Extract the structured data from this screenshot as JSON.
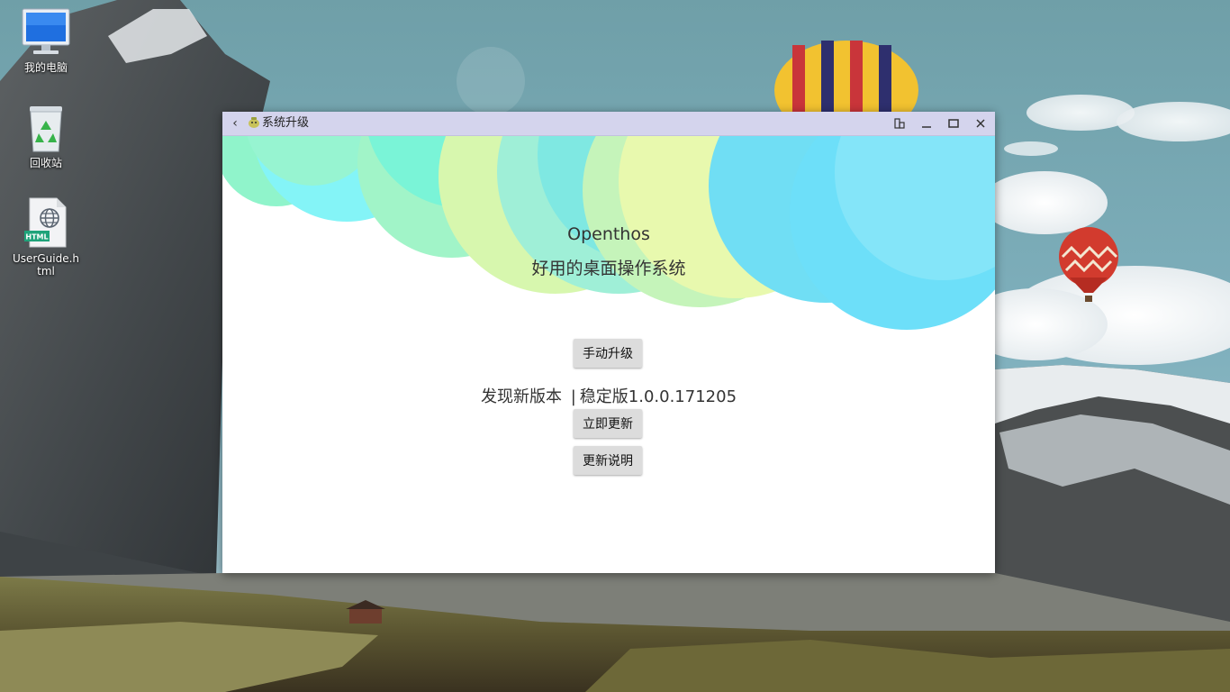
{
  "desktop": {
    "icons": [
      {
        "label": "我的电脑",
        "icon": "computer-icon"
      },
      {
        "label": "回收站",
        "icon": "recycle-bin-icon"
      },
      {
        "label": "UserGuide.html",
        "icon": "html-file-icon",
        "badge": "HTML"
      }
    ]
  },
  "window": {
    "title": "系统升级",
    "controls": [
      "back-icon",
      "app-icon",
      "compat-mode-icon",
      "minimize-icon",
      "maximize-icon",
      "close-icon"
    ]
  },
  "hero": {
    "brand": "Openthos",
    "slogan": "好用的桌面操作系统"
  },
  "actions": {
    "manual_upgrade": "手动升级",
    "update_now": "立即更新",
    "release_notes": "更新说明"
  },
  "update": {
    "found_text": "发现新版本",
    "separator": "|",
    "channel": "稳定版",
    "version": "1.0.0.171205"
  },
  "colors": {
    "titlebar": "#d4d4ed",
    "bubble_green": "#66f0b8",
    "bubble_lime": "#c8f590",
    "bubble_cyan": "#3dd9f5"
  }
}
